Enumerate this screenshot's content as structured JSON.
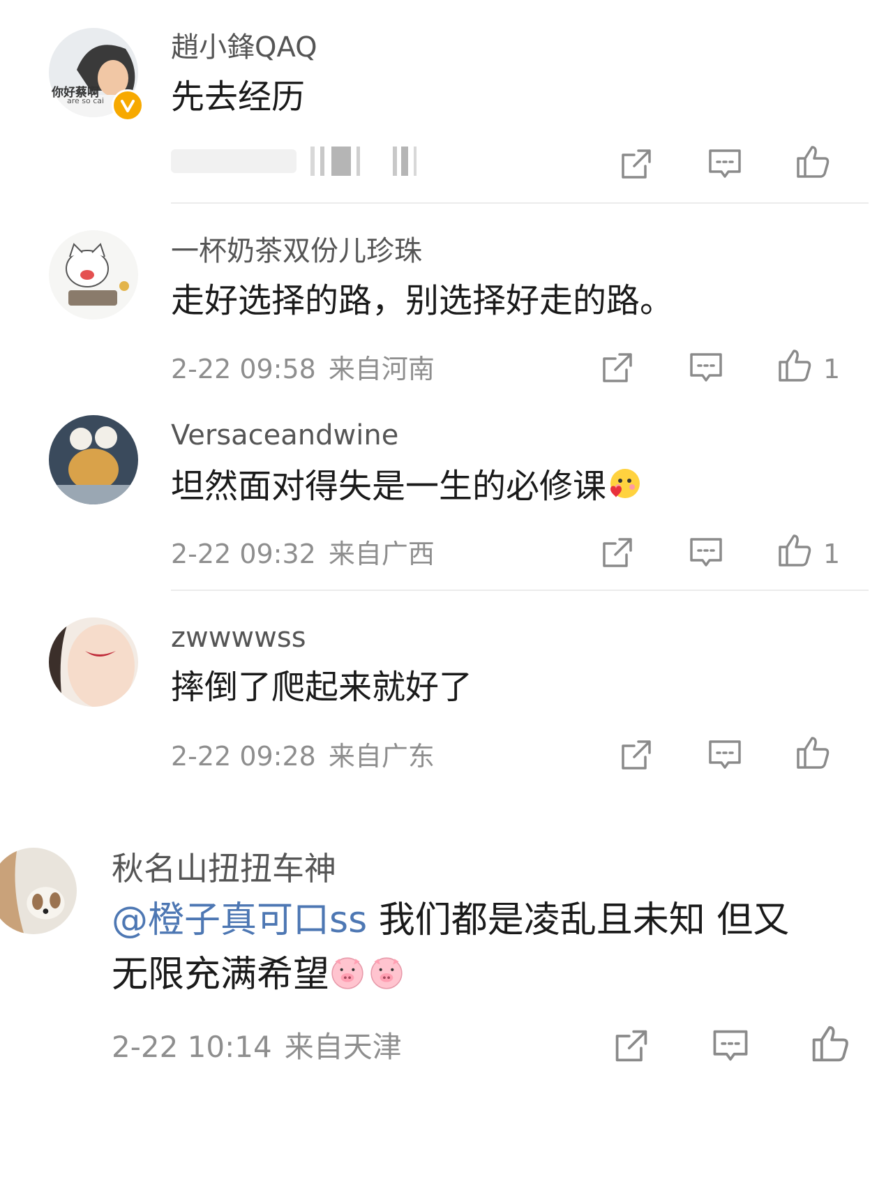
{
  "comments": [
    {
      "username": "趙小鋒QAQ",
      "text": "先去经历",
      "avatar_icon": "person-avatar",
      "avatar_caption": "你好蔡啊",
      "avatar_subcaption": "are so cai",
      "verified": true,
      "time": "",
      "location": "",
      "likes": ""
    },
    {
      "username": "一杯奶茶双份儿珍珠",
      "text": "走好选择的路，别选择好走的路。",
      "avatar_icon": "cartoon-cat-avatar",
      "time": "2-22 09:58",
      "location": "来自河南",
      "likes": "1"
    },
    {
      "username": "Versaceandwine",
      "text": "坦然面对得失是一生的必修课",
      "trailing_emoji": "blush-heart-emoji",
      "avatar_icon": "plush-toy-avatar",
      "time": "2-22 09:32",
      "location": "来自广西",
      "likes": "1"
    },
    {
      "username": "zwwwwss",
      "text": "摔倒了爬起来就好了",
      "avatar_icon": "face-photo-avatar",
      "time": "2-22 09:28",
      "location": "来自广东",
      "likes": ""
    },
    {
      "username": "秋名山扭扭车神",
      "mention": "@橙子真可口ss",
      "text_line1": " 我们都是凌乱且未知 但又",
      "text_line2": "无限充满希望",
      "trailing_emoji": "pig-emoji",
      "avatar_icon": "dog-photo-avatar",
      "time": "2-22 10:14",
      "location": "来自天津",
      "likes": ""
    }
  ],
  "colors": {
    "username": "#555555",
    "text": "#1a1a1a",
    "meta": "#8e8e8e",
    "mention": "#4d77b3",
    "icon": "#8a8a8a",
    "verified_badge": "#f7a900",
    "divider": "#ebebeb"
  },
  "action_icons": [
    "share-icon",
    "comment-icon",
    "like-icon"
  ]
}
